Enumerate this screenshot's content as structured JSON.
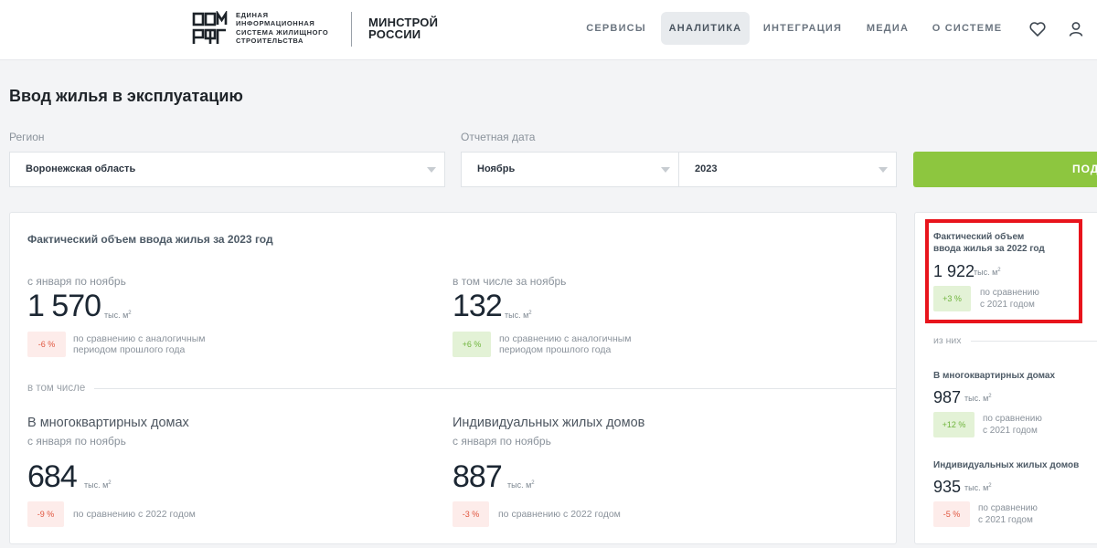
{
  "header": {
    "logo_text_lines": [
      "ЕДИНАЯ",
      "ИНФОРМАЦИОННАЯ",
      "СИСТЕМА ЖИЛИЩНОГО",
      "СТРОИТЕЛЬСТВА"
    ],
    "ministry_lines": [
      "МИНСТРОЙ",
      "РОССИИ"
    ],
    "nav": [
      "СЕРВИСЫ",
      "АНАЛИТИКА",
      "ИНТЕГРАЦИЯ",
      "МЕДИА",
      "О СИСТЕМЕ"
    ],
    "active_nav": "АНАЛИТИКА"
  },
  "page": {
    "title": "Ввод жилья в эксплуатацию"
  },
  "filters": {
    "region_label": "Регион",
    "region_value": "Воронежская область",
    "date_label": "Отчетная дата",
    "month_value": "Ноябрь",
    "year_value": "2023",
    "submit_label": "ПОД"
  },
  "main": {
    "title": "Фактический объем ввода жилья за 2023 год",
    "ytd": {
      "period": "с января по ноябрь",
      "value": "1 570",
      "unit": "тыс. м",
      "change": "-6 %",
      "compare": [
        "по сравнению с аналогичным",
        "периодом прошлого года"
      ]
    },
    "month": {
      "period": "в том числе за ноябрь",
      "value": "132",
      "unit": "тыс. м",
      "change": "+6 %",
      "compare": [
        "по сравнению с аналогичным",
        "периодом прошлого года"
      ]
    },
    "section_label": "в том числе",
    "apartments": {
      "title": "В многоквартирных домах",
      "period": "с января по ноябрь",
      "value": "684",
      "unit": "тыс. м",
      "change": "-9 %",
      "compare": "по сравнению с 2022 годом"
    },
    "houses": {
      "title": "Индивидуальных жилых домов",
      "period": "с января по ноябрь",
      "value": "887",
      "unit": "тыс. м",
      "change": "-3 %",
      "compare": "по сравнению с 2022 годом"
    }
  },
  "side": {
    "title": [
      "Фактический объем",
      "ввода жилья за 2022 год"
    ],
    "value": "1 922",
    "unit": "тыс. м",
    "change": "+3 %",
    "compare": [
      "по сравнению",
      "с 2021 годом"
    ],
    "of_them": "из них",
    "apartments": {
      "title": "В многоквартирных домах",
      "value": "987",
      "unit": "тыс. м",
      "change": "+12 %",
      "compare": [
        "по сравнению",
        "с 2021 годом"
      ]
    },
    "houses": {
      "title": "Индивидуальных жилых домов",
      "value": "935",
      "unit": "тыс. м",
      "change": "-5 %",
      "compare": [
        "по сравнению",
        "с 2021 годом"
      ]
    }
  },
  "colors": {
    "accent_green": "#8dc63f",
    "negative": "#e0563f",
    "positive": "#6fb43c",
    "highlight": "#e8141c"
  }
}
